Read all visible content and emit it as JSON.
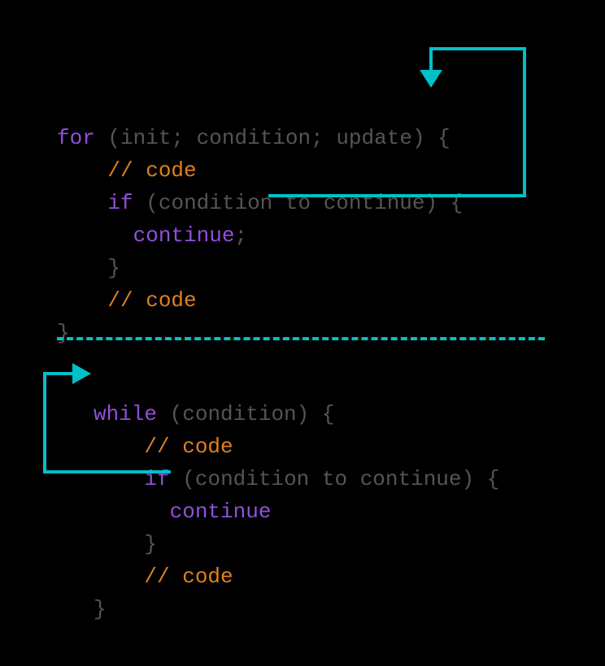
{
  "colors": {
    "keyword": "#9050d8",
    "comment": "#e08020",
    "punct": "#555555",
    "arrow": "#00c0c8",
    "bg": "#000000"
  },
  "for_block": {
    "l1": {
      "kw": "for",
      "open": " (",
      "init": "init",
      "sep1": "; ",
      "cond": "condition",
      "sep2": "; ",
      "upd": "update",
      "close": ") {"
    },
    "l2": {
      "indent": "    ",
      "cm": "// code"
    },
    "l3": {
      "indent": "    ",
      "kw": "if",
      "open": " (",
      "cond": "condition to continue",
      "close": ") {"
    },
    "l4": {
      "indent": "      ",
      "kw": "continue",
      "semi": ";"
    },
    "l5": {
      "indent": "    ",
      "brace": "}"
    },
    "l6": {
      "indent": "    ",
      "cm": "// code"
    },
    "l7": {
      "brace": "}"
    }
  },
  "while_block": {
    "l1": {
      "kw": "while",
      "open": " (",
      "cond": "condition",
      "close": ") {"
    },
    "l2": {
      "indent": "    ",
      "cm": "// code"
    },
    "l3": {
      "indent": "    ",
      "kw": "if",
      "open": " (",
      "cond": "condition to continue",
      "close": ") {"
    },
    "l4": {
      "indent": "      ",
      "kw": "continue"
    },
    "l5": {
      "indent": "    ",
      "brace": "}"
    },
    "l6": {
      "indent": "    ",
      "cm": "// code"
    },
    "l7": {
      "brace": "}"
    }
  }
}
